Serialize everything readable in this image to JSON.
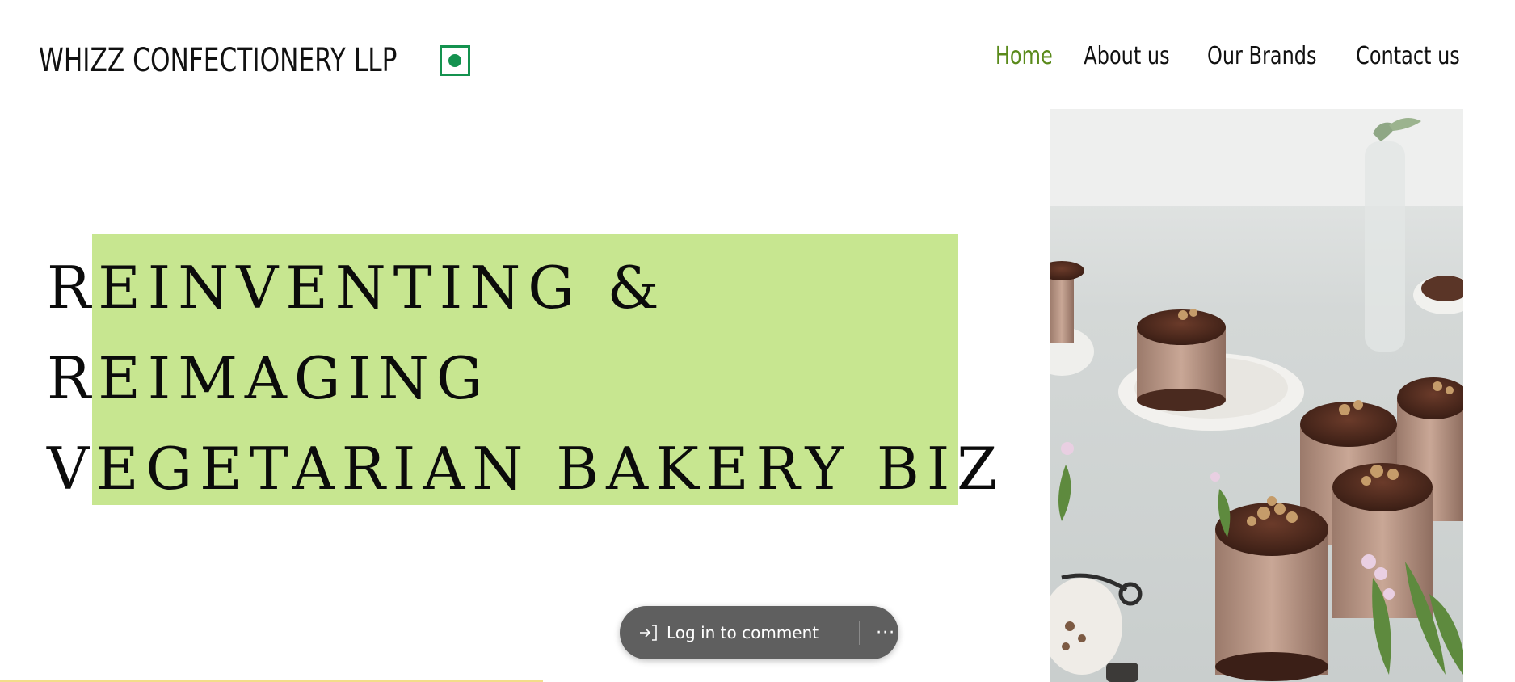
{
  "brand": {
    "name": "WHIZZ CONFECTIONERY LLP"
  },
  "nav": {
    "items": [
      "Home",
      "About us",
      "Our Brands",
      "Contact us"
    ],
    "active": "Home"
  },
  "hero": {
    "lines": [
      "REINVENTING &",
      "REIMAGING",
      "VEGETARIAN BAKERY BIZ"
    ]
  },
  "comment_bar": {
    "login_label": "Log in to comment",
    "more_label": "···"
  },
  "colors": {
    "accent_green": "#5a8a1b",
    "highlight": "#c7e690",
    "veg_mark": "#14924f",
    "pill": "#5f5f5f"
  },
  "icons": [
    "veg-mark-icon",
    "login-arrow-icon",
    "more-dots-icon"
  ]
}
